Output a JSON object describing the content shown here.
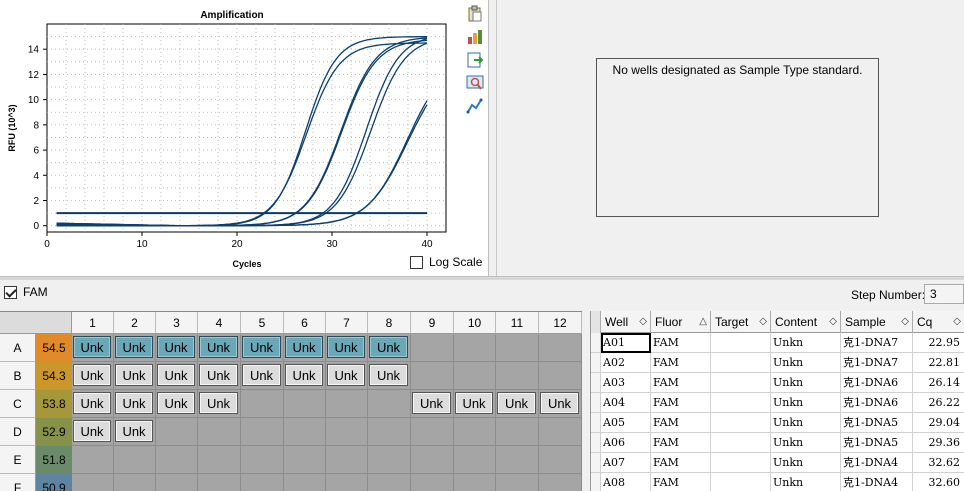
{
  "chart_data": {
    "type": "line",
    "title": "Amplification",
    "xlabel": "Cycles",
    "ylabel": "RFU (10^3)",
    "xlim": [
      0,
      42
    ],
    "ylim": [
      -0.5,
      16
    ],
    "x_ticks": [
      0,
      10,
      20,
      30,
      40
    ],
    "y_ticks": [
      0,
      2,
      4,
      6,
      8,
      10,
      12,
      14
    ],
    "threshold": 1.0,
    "grid": true,
    "series": [
      {
        "cq": 22.95,
        "plateau": 15.0,
        "k": 0.62,
        "baseline": 0.2
      },
      {
        "cq": 22.81,
        "plateau": 14.5,
        "k": 0.58,
        "baseline": 0.2
      },
      {
        "cq": 26.14,
        "plateau": 15.0,
        "k": 0.55,
        "baseline": 0.1
      },
      {
        "cq": 26.22,
        "plateau": 14.8,
        "k": 0.55,
        "baseline": 0.1
      },
      {
        "cq": 29.04,
        "plateau": 15.2,
        "k": 0.58,
        "baseline": 0.0
      },
      {
        "cq": 29.36,
        "plateau": 15.0,
        "k": 0.56,
        "baseline": 0.0
      },
      {
        "cq": 32.62,
        "plateau": 13.5,
        "k": 0.48,
        "baseline": 0.0
      },
      {
        "cq": 32.6,
        "plateau": 13.2,
        "k": 0.47,
        "baseline": 0.0
      }
    ]
  },
  "chart_pane": {
    "log_scale_label": "Log Scale",
    "log_scale_checked": false,
    "tools": [
      "clipboard-icon",
      "chart-properties-icon",
      "export-icon",
      "zoom-icon",
      "line-style-icon"
    ]
  },
  "standard_curve": {
    "message": "No wells designated as Sample Type standard."
  },
  "fluor_bar": {
    "fam_label": "FAM",
    "fam_checked": true,
    "step_label": "Step Number:",
    "step_value": "3"
  },
  "plate": {
    "columns": [
      "1",
      "2",
      "3",
      "4",
      "5",
      "6",
      "7",
      "8",
      "9",
      "10",
      "11",
      "12"
    ],
    "rows": [
      {
        "label": "A",
        "temp": "54.5",
        "color": "#e08a2a",
        "wells": [
          "Unk",
          "Unk",
          "Unk",
          "Unk",
          "Unk",
          "Unk",
          "Unk",
          "Unk",
          "",
          "",
          "",
          ""
        ],
        "style": "blue"
      },
      {
        "label": "B",
        "temp": "54.3",
        "color": "#c9972c",
        "wells": [
          "Unk",
          "Unk",
          "Unk",
          "Unk",
          "Unk",
          "Unk",
          "Unk",
          "Unk",
          "",
          "",
          "",
          ""
        ],
        "style": "gray"
      },
      {
        "label": "C",
        "temp": "53.8",
        "color": "#a5973a",
        "wells": [
          "Unk",
          "Unk",
          "Unk",
          "Unk",
          "",
          "",
          "",
          "",
          "Unk",
          "Unk",
          "Unk",
          "Unk"
        ],
        "style": "gray"
      },
      {
        "label": "D",
        "temp": "52.9",
        "color": "#86924a",
        "wells": [
          "Unk",
          "Unk",
          "",
          "",
          "",
          "",
          "",
          "",
          "",
          "",
          "",
          ""
        ],
        "style": "gray"
      },
      {
        "label": "E",
        "temp": "51.8",
        "color": "#6a8a6a",
        "wells": [
          "",
          "",
          "",
          "",
          "",
          "",
          "",
          "",
          "",
          "",
          "",
          ""
        ],
        "style": "gray"
      },
      {
        "label": "F",
        "temp": "50.9",
        "color": "#5d84a0",
        "wells": [
          "",
          "",
          "",
          "",
          "",
          "",
          "",
          "",
          "",
          "",
          "",
          ""
        ],
        "style": "gray"
      }
    ]
  },
  "table": {
    "headers": [
      {
        "label": "Well",
        "arrow": "◇"
      },
      {
        "label": "Fluor",
        "arrow": "△"
      },
      {
        "label": "Target",
        "arrow": "◇"
      },
      {
        "label": "Content",
        "arrow": "◇"
      },
      {
        "label": "Sample",
        "arrow": "◇"
      },
      {
        "label": "Cq",
        "arrow": "◇"
      }
    ],
    "rows": [
      [
        "A01",
        "FAM",
        "",
        "Unkn",
        "克1-DNA7",
        "22.95"
      ],
      [
        "A02",
        "FAM",
        "",
        "Unkn",
        "克1-DNA7",
        "22.81"
      ],
      [
        "A03",
        "FAM",
        "",
        "Unkn",
        "克1-DNA6",
        "26.14"
      ],
      [
        "A04",
        "FAM",
        "",
        "Unkn",
        "克1-DNA6",
        "26.22"
      ],
      [
        "A05",
        "FAM",
        "",
        "Unkn",
        "克1-DNA5",
        "29.04"
      ],
      [
        "A06",
        "FAM",
        "",
        "Unkn",
        "克1-DNA5",
        "29.36"
      ],
      [
        "A07",
        "FAM",
        "",
        "Unkn",
        "克1-DNA4",
        "32.62"
      ],
      [
        "A08",
        "FAM",
        "",
        "Unkn",
        "克1-DNA4",
        "32.60"
      ]
    ]
  }
}
